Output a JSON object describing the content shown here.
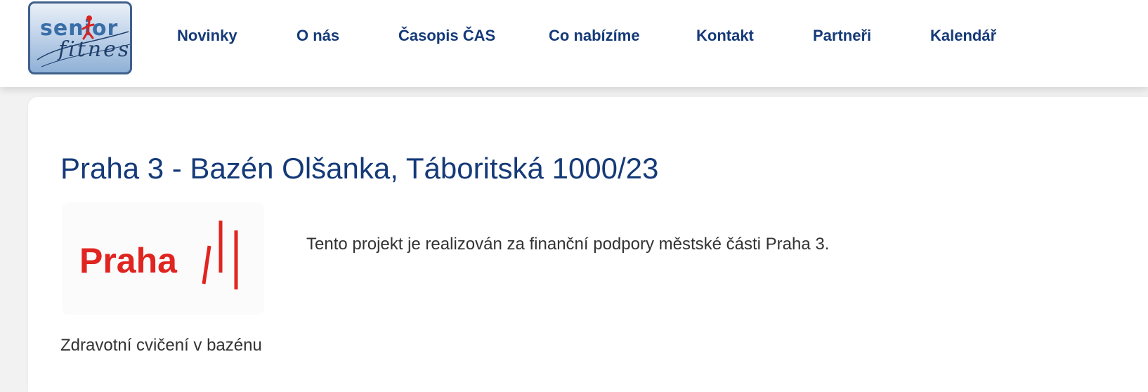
{
  "header": {
    "logo": {
      "line1": "senior",
      "line2": "fitnes",
      "icon": "running-figure-icon",
      "colors": {
        "border": "#3f5f8c",
        "text": "#3a6ea8",
        "figure": "#d9231f"
      }
    },
    "nav": [
      {
        "label": "Novinky"
      },
      {
        "label": "O nás"
      },
      {
        "label": "Časopis ČAS"
      },
      {
        "label": "Co nabízíme"
      },
      {
        "label": "Kontakt"
      },
      {
        "label": "Partneři"
      },
      {
        "label": "Kalendář"
      }
    ],
    "nav_color": "#153a78"
  },
  "main": {
    "title": "Praha 3 - Bazén Olšanka, Táboritská 1000/23",
    "sponsor_logo": {
      "text": "Praha",
      "color": "#e02521",
      "icon": "praha-bars-icon"
    },
    "project_text": "Tento projekt je realizován za finanční podpory městské části Praha 3.",
    "subheading": "Zdravotní cvičení v bazénu"
  }
}
